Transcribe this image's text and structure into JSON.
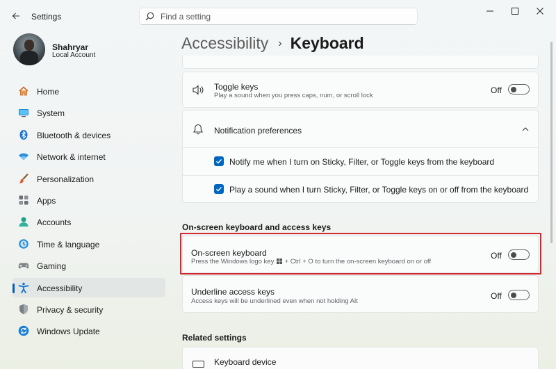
{
  "window": {
    "title": "Settings",
    "controls": {
      "minimize": "—",
      "maximize": "☐",
      "close": "✕"
    }
  },
  "search": {
    "placeholder": "Find a setting",
    "value": ""
  },
  "profile": {
    "name": "Shahryar",
    "account_type": "Local Account"
  },
  "sidebar": {
    "items": [
      {
        "label": "Home",
        "icon": "home-icon"
      },
      {
        "label": "System",
        "icon": "system-icon"
      },
      {
        "label": "Bluetooth & devices",
        "icon": "bluetooth-icon"
      },
      {
        "label": "Network & internet",
        "icon": "wifi-icon"
      },
      {
        "label": "Personalization",
        "icon": "brush-icon"
      },
      {
        "label": "Apps",
        "icon": "apps-icon"
      },
      {
        "label": "Accounts",
        "icon": "accounts-icon"
      },
      {
        "label": "Time & language",
        "icon": "clock-globe-icon"
      },
      {
        "label": "Gaming",
        "icon": "gamepad-icon"
      },
      {
        "label": "Accessibility",
        "icon": "accessibility-icon",
        "active": true
      },
      {
        "label": "Privacy & security",
        "icon": "shield-icon"
      },
      {
        "label": "Windows Update",
        "icon": "update-icon"
      }
    ]
  },
  "breadcrumb": {
    "parent": "Accessibility",
    "separator": "›",
    "current": "Keyboard"
  },
  "toggle_keys": {
    "title": "Toggle keys",
    "description": "Play a sound when you press caps, num, or scroll lock",
    "state_label": "Off",
    "on": false
  },
  "notification_preferences": {
    "title": "Notification preferences",
    "expanded": true,
    "options": [
      {
        "label": "Notify me when I turn on Sticky, Filter, or Toggle keys from the keyboard",
        "checked": true
      },
      {
        "label": "Play a sound when I turn Sticky, Filter, or Toggle keys on or off from the keyboard",
        "checked": true
      }
    ]
  },
  "onscreen_section": {
    "heading": "On-screen keyboard and access keys",
    "onscreen_keyboard": {
      "title": "On-screen keyboard",
      "description_before": "Press the Windows logo key",
      "description_after": "+ Ctrl + O to turn the on-screen keyboard on or off",
      "state_label": "Off",
      "on": false
    },
    "underline_access_keys": {
      "title": "Underline access keys",
      "description": "Access keys will be underlined even when not holding Alt",
      "state_label": "Off",
      "on": false
    }
  },
  "related_settings": {
    "heading": "Related settings",
    "items": [
      {
        "label": "Keyboard device"
      }
    ]
  },
  "colors": {
    "accent": "#005fb8",
    "checkbox": "#0067c0",
    "highlight_border": "#d4262e"
  }
}
